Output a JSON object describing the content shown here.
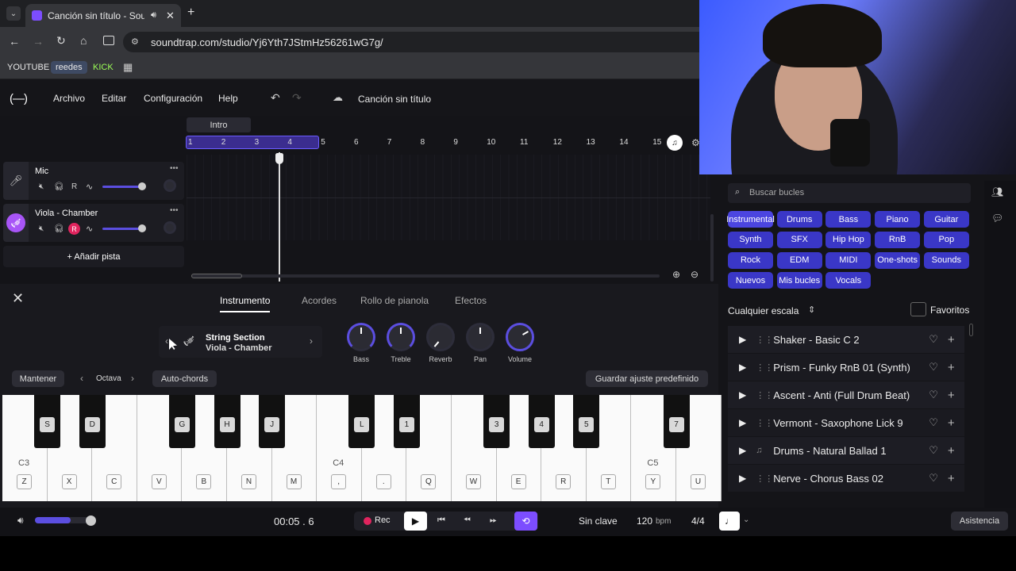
{
  "browser": {
    "tab_title": "Canción sin título - Soundtr",
    "url": "soundtrap.com/studio/Yj6Yth7JStmHz56261wG7g/",
    "bookmarks": [
      "YOUTUBE",
      "reedes",
      "KICK"
    ]
  },
  "menu": {
    "archivo": "Archivo",
    "editar": "Editar",
    "configuracion": "Configuración",
    "help": "Help",
    "song_title": "Canción sin título"
  },
  "timeline": {
    "section": "Intro",
    "bars": [
      "1",
      "2",
      "3",
      "4",
      "5",
      "6",
      "7",
      "8",
      "9",
      "10",
      "11",
      "12",
      "13",
      "14",
      "15"
    ]
  },
  "tracks": [
    {
      "name": "Mic",
      "rec": "R"
    },
    {
      "name": "Viola - Chamber",
      "rec": "R"
    }
  ],
  "add_track": "+ Añadir pista",
  "editor": {
    "tabs": [
      "Instrumento",
      "Acordes",
      "Rollo de pianola",
      "Efectos"
    ],
    "instrument_category": "String Section",
    "instrument_name": "Viola - Chamber",
    "knobs": [
      "Bass",
      "Treble",
      "Reverb",
      "Pan",
      "Volume"
    ],
    "mantener": "Mantener",
    "octava": "Octava",
    "autochords": "Auto-chords",
    "save_preset": "Guardar ajuste predefinido"
  },
  "piano": {
    "white_keys": [
      "Z",
      "X",
      "C",
      "V",
      "B",
      "N",
      "M",
      ",",
      ".",
      "Q",
      "W",
      "E",
      "R",
      "T",
      "Y",
      "U"
    ],
    "black_keys": [
      "S",
      "D",
      "G",
      "H",
      "J",
      "L",
      "1",
      "3",
      "4",
      "5",
      "7"
    ],
    "octave_labels": [
      "C3",
      "C4",
      "C5"
    ]
  },
  "sidebar": {
    "search_placeholder": "Buscar bucles",
    "categories": [
      [
        "Instrumental",
        "Drums",
        "Bass",
        "Piano",
        "Guitar"
      ],
      [
        "Synth",
        "SFX",
        "Hip Hop",
        "RnB",
        "Pop"
      ],
      [
        "Rock",
        "EDM",
        "MIDI",
        "One-shots",
        "Sounds"
      ],
      [
        "Nuevos",
        "Mis bucles",
        "Vocals"
      ]
    ],
    "scale": "Cualquier escala",
    "favorites": "Favoritos",
    "loops": [
      "Shaker - Basic C 2",
      "Prism - Funky RnB 01 (Synth)",
      "Ascent - Anti (Full Drum Beat)",
      "Vermont - Saxophone Lick 9",
      "Drums - Natural Ballad 1",
      "Nerve - Chorus Bass 02"
    ]
  },
  "transport": {
    "time": "00:05 . 6",
    "rec": "Rec",
    "key": "Sin clave",
    "tempo": "120",
    "bpm": "bpm",
    "meter": "4/4",
    "help": "Asistencia",
    "master_volume": 0.62
  },
  "colors": {
    "accent": "#7c4dff",
    "track_purple": "#a855f7",
    "blue_pill": "#3a37c7",
    "rec_red": "#e0245e"
  }
}
